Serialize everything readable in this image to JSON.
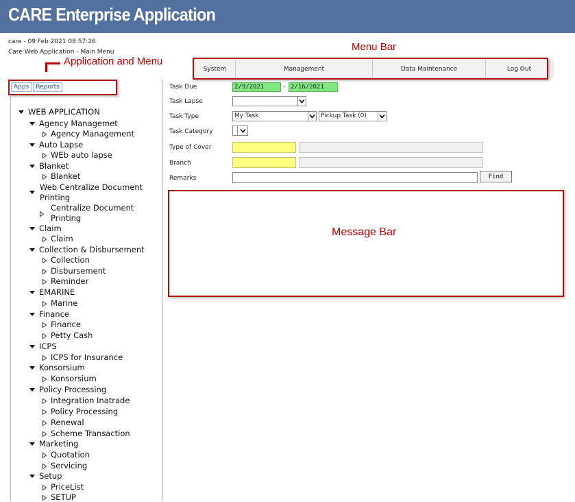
{
  "app": {
    "title": "CARE Enterprise Application",
    "session_line": "care - 09 Feb 2021 08:57:26",
    "subtitle_line": "Care Web Application - Main Menu"
  },
  "annotations": {
    "menu_bar_label": "Menu Bar",
    "app_menu_label": "Application and Menu",
    "message_bar_label": "Message Bar",
    "color": "#c00000"
  },
  "menu": {
    "items": [
      {
        "label": "System"
      },
      {
        "label": "Management"
      },
      {
        "label": "Data Maintenance"
      },
      {
        "label": "Log Out"
      }
    ]
  },
  "tabs": [
    {
      "label": "Apps",
      "active": true
    },
    {
      "label": "Reports",
      "active": false
    }
  ],
  "tree": {
    "root": "WEB APPLICATION",
    "groups": [
      {
        "label": "Agency Managemet",
        "children": [
          "Agency Management"
        ]
      },
      {
        "label": "Auto Lapse",
        "children": [
          "WEb auto lapse"
        ]
      },
      {
        "label": "Blanket",
        "children": [
          "Blanket"
        ]
      },
      {
        "label_line1": "Web Centralize Document",
        "label_line2": "Printing",
        "children_lines": [
          "Centralize Document",
          "Printing"
        ]
      },
      {
        "label": "Claim",
        "children": [
          "Claim"
        ]
      },
      {
        "label": "Collection & Disbursement",
        "children": [
          "Collection",
          "Disbursement",
          "Reminder"
        ]
      },
      {
        "label": "EMARINE",
        "children": [
          "Marine"
        ]
      },
      {
        "label": "Finance",
        "children": [
          "Finance",
          "Petty Cash"
        ]
      },
      {
        "label": "ICPS",
        "children": [
          "ICPS for Insurance"
        ]
      },
      {
        "label": "Konsorsium",
        "children": [
          "Konsorsium"
        ]
      },
      {
        "label": "Policy Processing",
        "children": [
          "Integration Inatrade",
          "Policy Processing",
          "Renewal",
          "Scheme Transaction"
        ]
      },
      {
        "label": "Marketing",
        "children": [
          "Quotation",
          "Servicing"
        ]
      },
      {
        "label": "Setup",
        "children": [
          "PriceList",
          "SETUP"
        ]
      }
    ]
  },
  "form": {
    "task_due_label": "Task Due",
    "task_due_from": "2/9/2021",
    "task_due_to": "2/16/2021",
    "task_due_sep": "-",
    "task_lapse_label": "Task Lapse",
    "task_lapse_value": "",
    "task_type_label": "Task Type",
    "task_type_value": "My Task",
    "pickup_value": "Pickup Task (0)",
    "task_category_label": "Task Category",
    "task_category_value": "",
    "type_of_cover_label": "Type of Cover",
    "type_of_cover_code": "",
    "type_of_cover_desc": "",
    "branch_label": "Branch",
    "branch_code": "",
    "branch_desc": "",
    "remarks_label": "Remarks",
    "remarks_value": "",
    "find_label": "Find"
  },
  "colors": {
    "header": "#52719f",
    "date_field": "#7fe87f",
    "required_field": "#ffff80"
  }
}
